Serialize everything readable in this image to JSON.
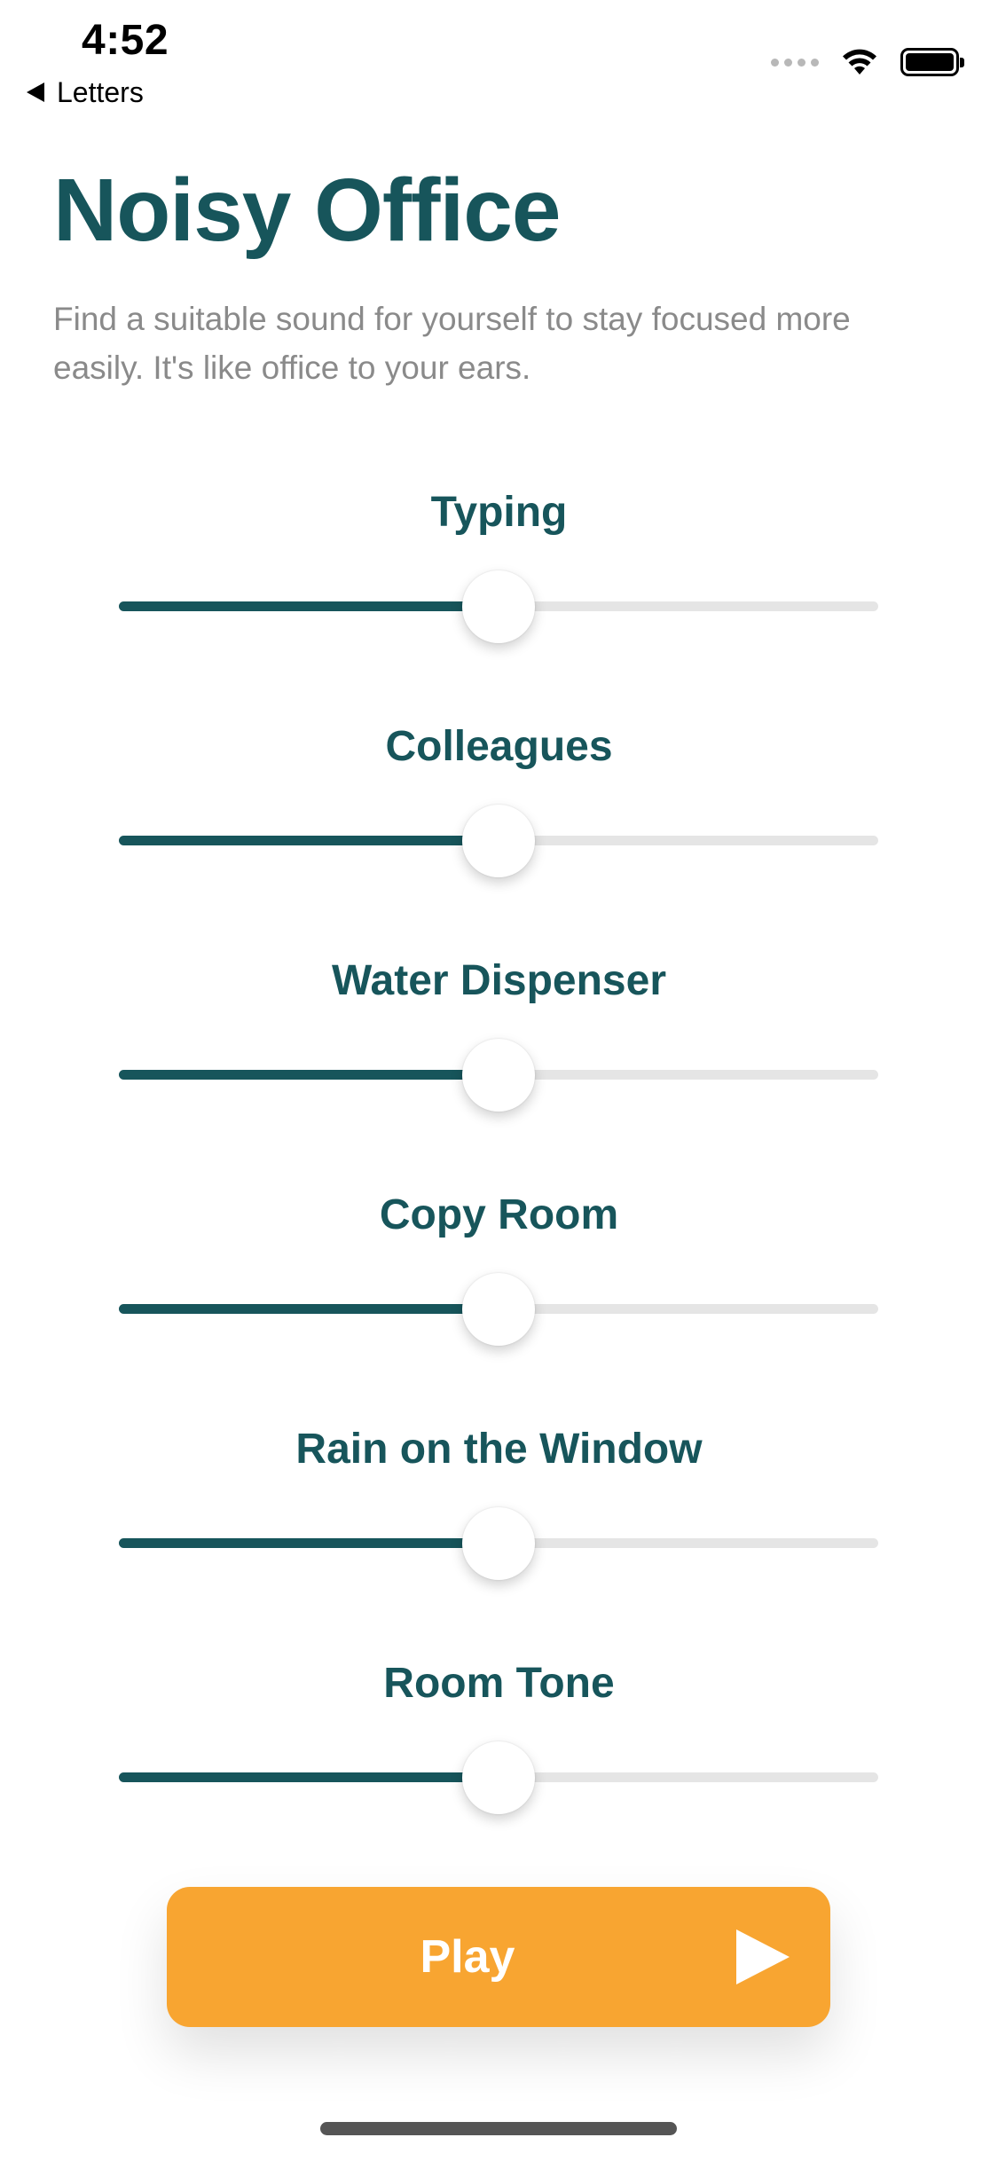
{
  "status_bar": {
    "time": "4:52",
    "back_label": "Letters",
    "icons": [
      "signal-icon",
      "wifi-icon",
      "battery-icon"
    ]
  },
  "header": {
    "title": "Noisy Office",
    "subtitle": "Find a suitable sound for yourself to stay focused more easily. It's like office to your ears."
  },
  "sliders": [
    {
      "label": "Typing",
      "value": 0.5
    },
    {
      "label": "Colleagues",
      "value": 0.5
    },
    {
      "label": "Water Dispenser",
      "value": 0.5
    },
    {
      "label": "Copy Room",
      "value": 0.5
    },
    {
      "label": "Rain on the Window",
      "value": 0.5
    },
    {
      "label": "Room Tone",
      "value": 0.5
    }
  ],
  "play_button": {
    "label": "Play",
    "icon": "play-icon"
  },
  "colors": {
    "primary": "#17555b",
    "accent": "#f8a531",
    "track": "#e5e5e5",
    "subtitle": "#8a8a8a"
  }
}
